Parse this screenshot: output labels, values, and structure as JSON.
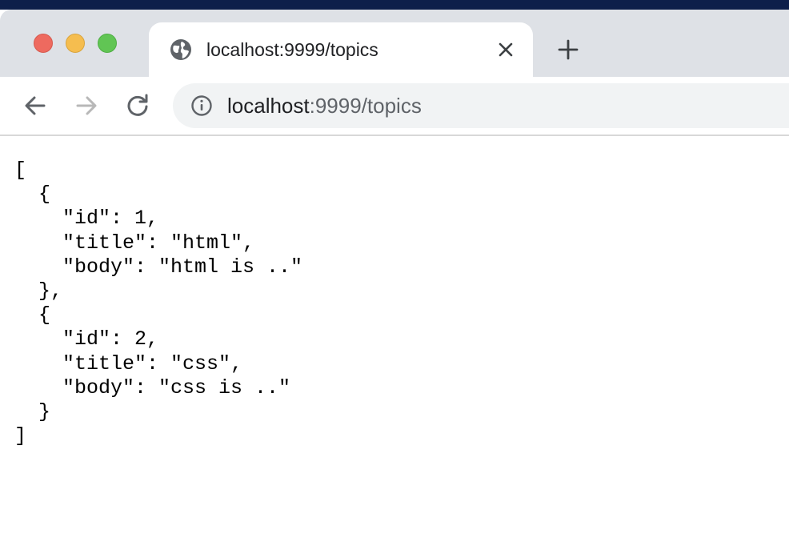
{
  "tab": {
    "title": "localhost:9999/topics"
  },
  "address_bar": {
    "host": "localhost",
    "rest": ":9999/topics"
  },
  "icons": {
    "favicon": "globe-icon",
    "tab_close": "close-icon",
    "new_tab": "plus-icon",
    "back": "back-arrow-icon",
    "forward": "forward-arrow-icon",
    "reload": "reload-icon",
    "site_info": "info-icon"
  },
  "colors": {
    "tabbar_bg": "#dee1e6",
    "omnibox_bg": "#f1f3f4",
    "close_light": "#ee6a5f",
    "minimize_light": "#f5bd4f",
    "maximize_light": "#61c554"
  },
  "json_lines": [
    "[",
    "  {",
    "    \"id\": 1,",
    "    \"title\": \"html\",",
    "    \"body\": \"html is ..\"",
    "  },",
    "  {",
    "    \"id\": 2,",
    "    \"title\": \"css\",",
    "    \"body\": \"css is ..\"",
    "  }",
    "]"
  ]
}
